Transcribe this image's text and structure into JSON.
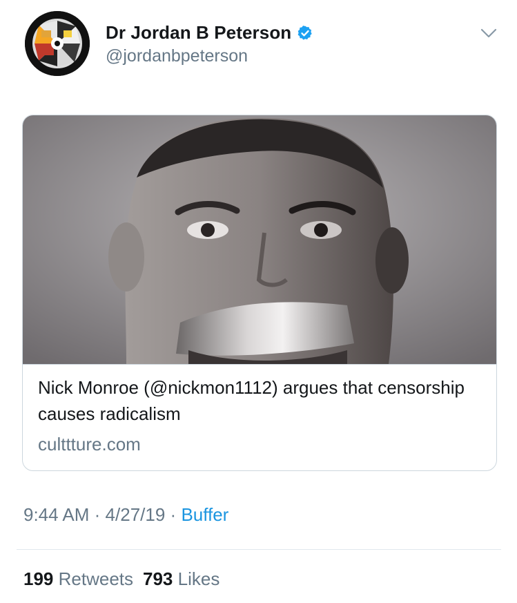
{
  "tweet": {
    "author": {
      "name": "Dr Jordan B Peterson",
      "handle": "@jordanbpeterson",
      "verified": true
    },
    "card": {
      "title": "Nick Monroe (@nickmon1112) argues that censorship causes radicalism",
      "domain": "culttture.com",
      "image_description_icon": "photo"
    },
    "meta": {
      "time": "9:44 AM",
      "separator": "·",
      "date": "4/27/19",
      "source": "Buffer"
    },
    "stats": {
      "retweets_count": "199",
      "retweets_label": "Retweets",
      "likes_count": "793",
      "likes_label": "Likes"
    }
  },
  "colors": {
    "primary_text": "#14171a",
    "secondary_text": "#657786",
    "link": "#1b95e0",
    "border": "#ccd6dd",
    "verified_badge": "#1da1f2"
  },
  "icons": {
    "verified": "verified-badge-icon",
    "menu": "chevron-down-icon"
  }
}
